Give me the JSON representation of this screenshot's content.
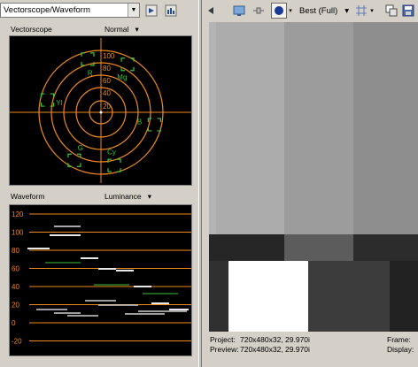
{
  "left_toolbar": {
    "scope_select_value": "Vectorscope/Waveform",
    "settings_icon": "scope-settings-icon",
    "update_icon": "update-scopes-icon"
  },
  "vectorscope": {
    "label": "Vectorscope",
    "mode": "Normal",
    "ring_labels": [
      "100",
      "80",
      "60",
      "40",
      "20"
    ],
    "color_targets": [
      "R",
      "Mg",
      "B",
      "Cy",
      "G",
      "Yl"
    ],
    "trace_color": "#f08a1e",
    "target_color": "#3cc43c"
  },
  "waveform": {
    "label": "Waveform",
    "mode": "Luminance",
    "y_labels": [
      "120",
      "100",
      "80",
      "60",
      "40",
      "20",
      "0",
      "-20"
    ],
    "grid_color": "#f08a1e"
  },
  "right_toolbar": {
    "quality_label": "Best (Full)",
    "icons": [
      "video-preview-icon",
      "split-screen-icon",
      "overlays-icon",
      "grid-icon",
      "copy-snapshot-icon",
      "save-snapshot-icon"
    ]
  },
  "status": {
    "project_label": "Project:",
    "project_value": "720x480x32, 29.970i",
    "preview_label": "Preview:",
    "preview_value": "720x480x32, 29.970i",
    "frame_label": "Frame:",
    "display_label": "Display:"
  }
}
